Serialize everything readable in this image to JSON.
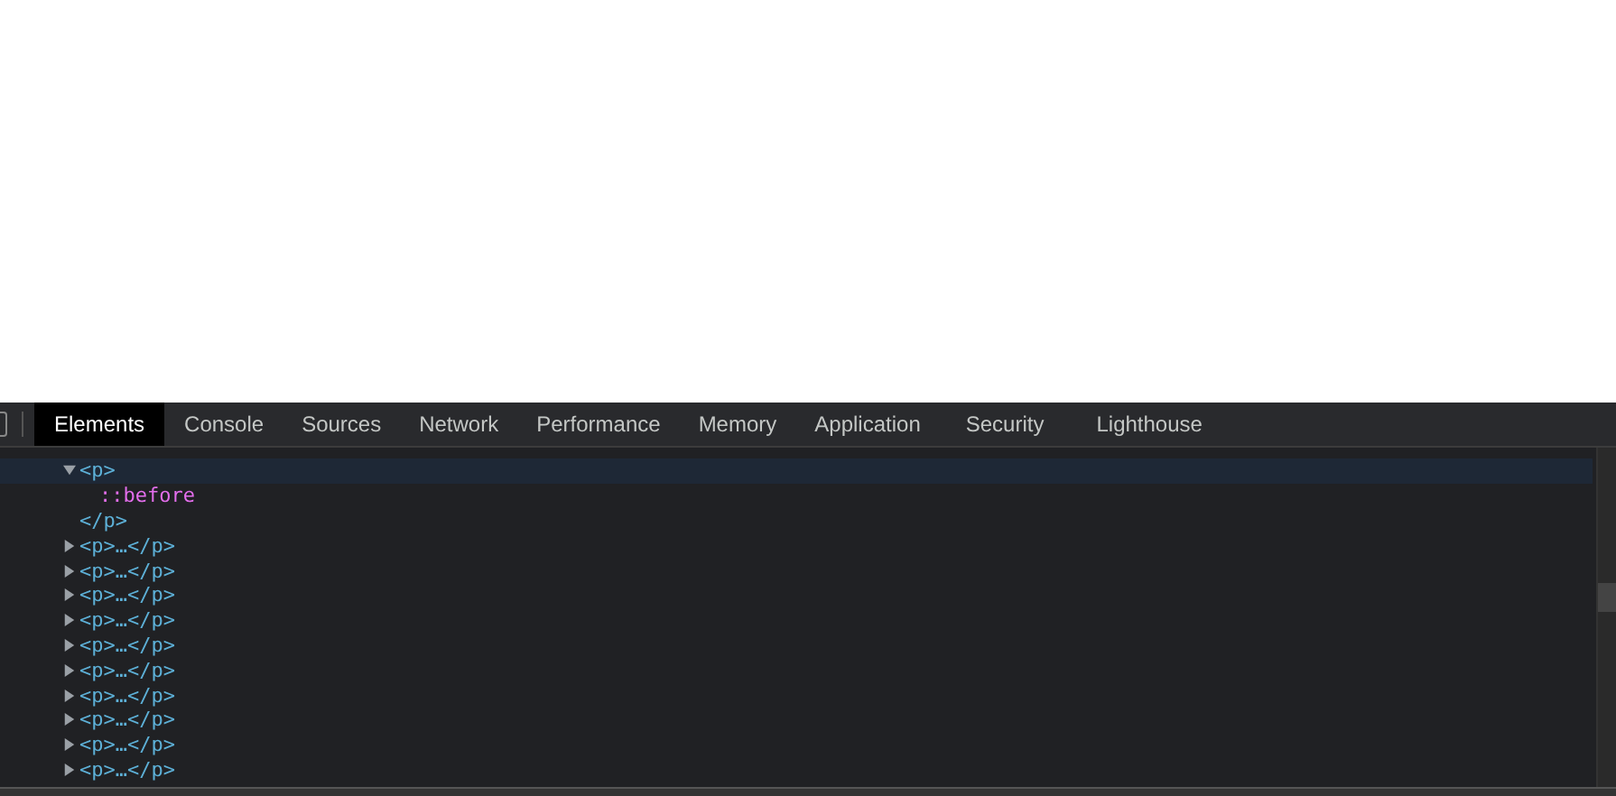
{
  "tabs": [
    {
      "label": "Elements",
      "selected": true
    },
    {
      "label": "Console",
      "selected": false
    },
    {
      "label": "Sources",
      "selected": false
    },
    {
      "label": "Network",
      "selected": false
    },
    {
      "label": "Performance",
      "selected": false
    },
    {
      "label": "Memory",
      "selected": false
    },
    {
      "label": "Application",
      "selected": false
    },
    {
      "label": "Security",
      "selected": false
    },
    {
      "label": "Lighthouse",
      "selected": false
    }
  ],
  "nodes": [
    {
      "open": "<p>",
      "close": "</p>",
      "expanded": true,
      "selected": true,
      "children": [
        {
          "kind": "pseudo",
          "text": "::before"
        }
      ]
    },
    {
      "open": "<p>…</p>",
      "expanded": false,
      "selected": false
    },
    {
      "open": "<p>…</p>",
      "expanded": false,
      "selected": false
    },
    {
      "open": "<p>…</p>",
      "expanded": false,
      "selected": false
    },
    {
      "open": "<p>…</p>",
      "expanded": false,
      "selected": false
    },
    {
      "open": "<p>…</p>",
      "expanded": false,
      "selected": false
    },
    {
      "open": "<p>…</p>",
      "expanded": false,
      "selected": false
    },
    {
      "open": "<p>…</p>",
      "expanded": false,
      "selected": false
    },
    {
      "open": "<p>…</p>",
      "expanded": false,
      "selected": false
    },
    {
      "open": "<p>…</p>",
      "expanded": false,
      "selected": false
    },
    {
      "open": "<p>…</p>",
      "expanded": false,
      "selected": false
    }
  ]
}
